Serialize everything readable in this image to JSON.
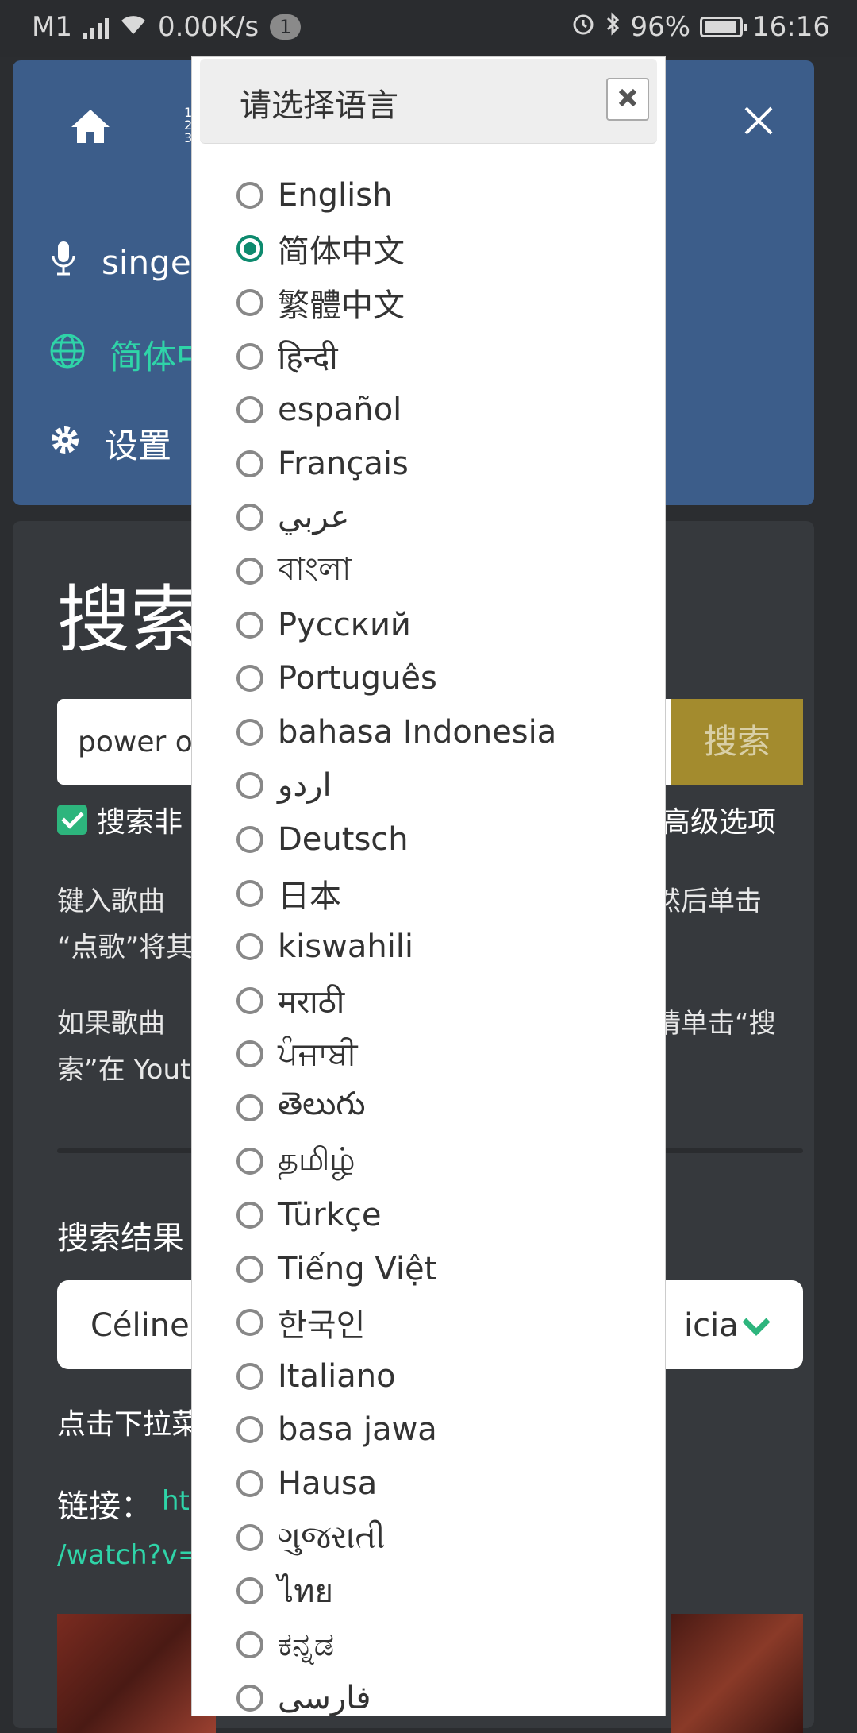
{
  "status_bar": {
    "carrier": "M1",
    "speed": "0.00K/s",
    "notification_count": "1",
    "battery": "96%",
    "time": "16:16"
  },
  "nav": {
    "items": [
      {
        "label": "singer",
        "icon": "microphone-icon"
      },
      {
        "label": "简体中",
        "icon": "globe-icon",
        "active": true
      },
      {
        "label": "设置",
        "icon": "gear-icon"
      }
    ]
  },
  "main": {
    "title": "搜索",
    "search_value": "power of",
    "search_button": "搜索",
    "checkbox_label": "搜索非",
    "advanced_label": "高级选项",
    "para1_line1_left": "键入歌曲",
    "para1_line1_right": "然后单击",
    "para1_line2": "“点歌”将其",
    "para2_line1_left": "如果歌曲",
    "para2_line1_right": "请单击“搜",
    "para2_line2": "索”在 Yout",
    "results_label": "搜索结果",
    "results_selected_left": "Céline",
    "results_selected_right": "icia",
    "hint": "点击下拉菜",
    "link_label": "链接：",
    "link_url_part": "ht",
    "link_url_line2": "/watch?v=Y"
  },
  "modal": {
    "title": "请选择语言",
    "languages": [
      {
        "label": "English",
        "checked": false
      },
      {
        "label": "简体中文",
        "checked": true
      },
      {
        "label": "繁體中文",
        "checked": false
      },
      {
        "label": "हिन्दी",
        "checked": false
      },
      {
        "label": "español",
        "checked": false
      },
      {
        "label": "Français",
        "checked": false
      },
      {
        "label": "عربي",
        "checked": false
      },
      {
        "label": "বাংলা",
        "checked": false
      },
      {
        "label": "Русский",
        "checked": false
      },
      {
        "label": "Português",
        "checked": false
      },
      {
        "label": "bahasa Indonesia",
        "checked": false
      },
      {
        "label": "اردو",
        "checked": false
      },
      {
        "label": "Deutsch",
        "checked": false
      },
      {
        "label": "日本",
        "checked": false
      },
      {
        "label": "kiswahili",
        "checked": false
      },
      {
        "label": "मराठी",
        "checked": false
      },
      {
        "label": "ਪੰਜਾਬੀ",
        "checked": false
      },
      {
        "label": "తెలుగు",
        "checked": false
      },
      {
        "label": "தமிழ்",
        "checked": false
      },
      {
        "label": "Türkçe",
        "checked": false
      },
      {
        "label": "Tiếng Việt",
        "checked": false
      },
      {
        "label": "한국인",
        "checked": false
      },
      {
        "label": "Italiano",
        "checked": false
      },
      {
        "label": "basa jawa",
        "checked": false
      },
      {
        "label": "Hausa",
        "checked": false
      },
      {
        "label": "ગુજરાતી",
        "checked": false
      },
      {
        "label": "ไทย",
        "checked": false
      },
      {
        "label": "ಕನ್ನಡ",
        "checked": false
      },
      {
        "label": "فارسی",
        "checked": false
      }
    ]
  }
}
